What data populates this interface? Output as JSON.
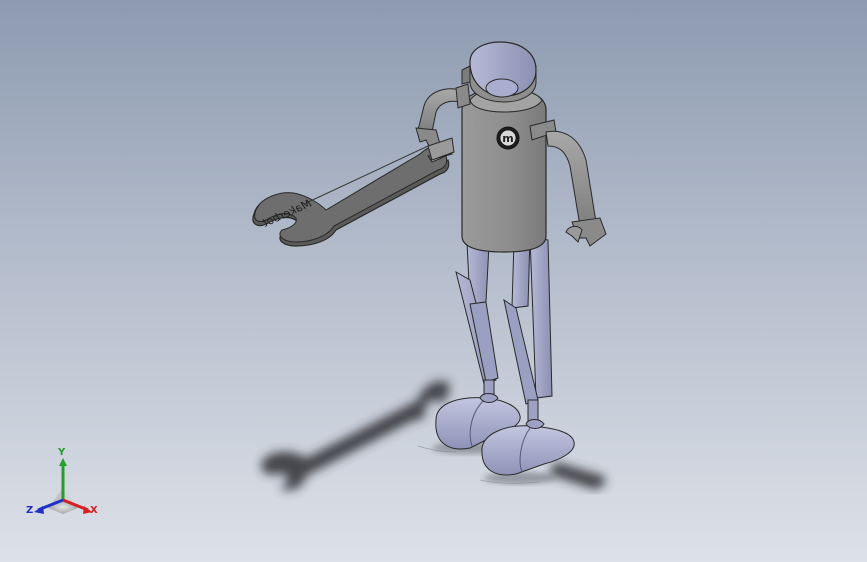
{
  "model": {
    "engraving_text": "Makerbot",
    "chest_logo": "m"
  },
  "triad": {
    "x_label": "X",
    "y_label": "Y",
    "z_label": "Z",
    "x_color": "#d42020",
    "y_color": "#22a02a",
    "z_color": "#2030c8"
  },
  "colors": {
    "background_top": "#8d9ab0",
    "background_bottom": "#dde1e8",
    "body_gray": "#8f8f8f",
    "limb_blue_gray": "#a5a9c9",
    "shadow": "#2e2e30"
  }
}
